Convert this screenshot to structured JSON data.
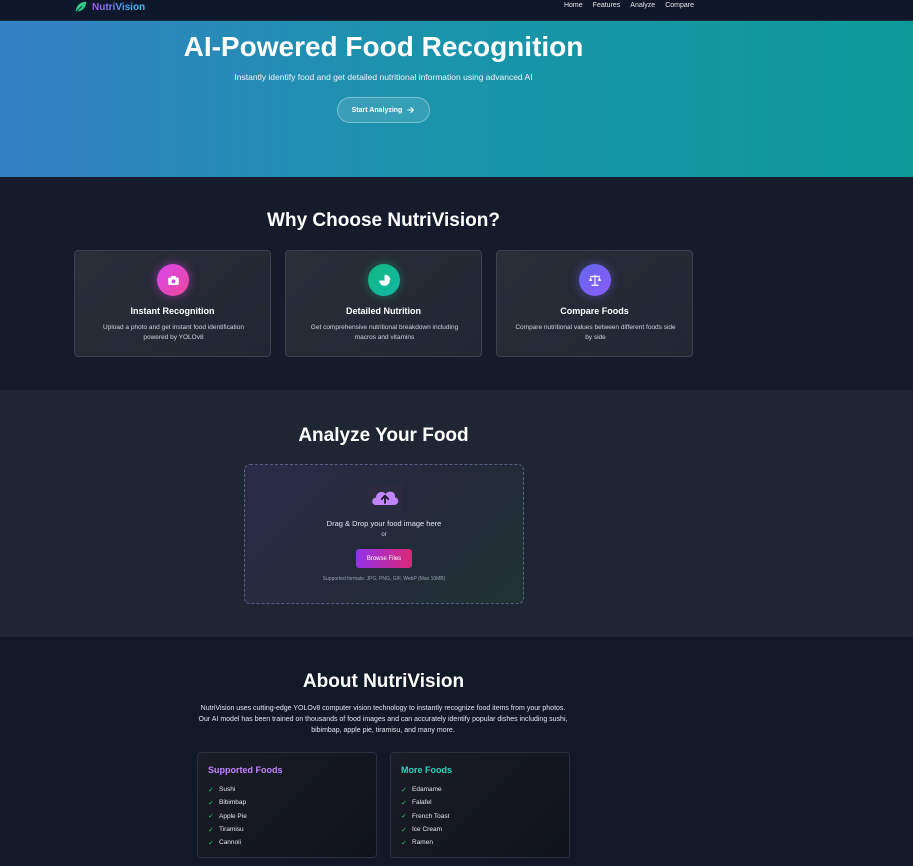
{
  "nav": {
    "brand": "NutriVision",
    "links": [
      "Home",
      "Features",
      "Analyze",
      "Compare"
    ]
  },
  "hero": {
    "title": "AI-Powered Food Recognition",
    "subtitle": "Instantly identify food and get detailed nutritional information using advanced AI",
    "cta": "Start Analyzing"
  },
  "why": {
    "title": "Why Choose NutriVision?",
    "cards": [
      {
        "title": "Instant Recognition",
        "desc": "Upload a photo and get instant food identification powered by YOLOv8",
        "icon": "camera-icon"
      },
      {
        "title": "Detailed Nutrition",
        "desc": "Get comprehensive nutritional breakdown including macros and vitamins",
        "icon": "pie-chart-icon"
      },
      {
        "title": "Compare Foods",
        "desc": "Compare nutritional values between different foods side by side",
        "icon": "balance-scale-icon"
      }
    ]
  },
  "analyze": {
    "title": "Analyze Your Food",
    "drop_text": "Drag & Drop your food image here",
    "or": "or",
    "browse": "Browse Files",
    "formats": "Supported formats: JPG, PNG, GIF, WebP (Max 10MB)"
  },
  "about": {
    "title": "About NutriVision",
    "text": "NutriVision uses cutting-edge YOLOv8 computer vision technology to instantly recognize food items from your photos. Our AI model has been trained on thousands of food images and can accurately identify popular dishes including sushi, bibimbap, apple pie, tiramisu, and many more.",
    "supported": {
      "title": "Supported Foods",
      "items": [
        "Sushi",
        "Bibimbap",
        "Apple Pie",
        "Tiramisu",
        "Cannoli"
      ]
    },
    "more": {
      "title": "More Foods",
      "items": [
        "Edamame",
        "Falafel",
        "French Toast",
        "Ice Cream",
        "Ramen"
      ]
    }
  },
  "colors": {
    "accent_purple": "#c084fc",
    "accent_teal": "#2dd4bf",
    "check_green": "#22c55e"
  }
}
